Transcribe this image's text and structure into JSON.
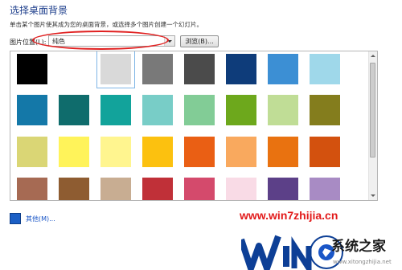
{
  "header": {
    "title": "选择桌面背景",
    "subtitle": "单击某个图片使其成为您的桌面背景，或选择多个图片创建一个幻灯片。"
  },
  "location": {
    "label": "图片位置(L):",
    "value": "纯色",
    "browse_label": "浏览(B)..."
  },
  "colors": [
    "#000000",
    "#ffffff",
    "#d9d9d9",
    "#797979",
    "#4b4b4b",
    "#0e3c7a",
    "#3c8fd4",
    "#9fd8ea",
    "#1478a8",
    "#0f6c6c",
    "#12a39b",
    "#78cdc7",
    "#82cc96",
    "#6da81c",
    "#c0dd96",
    "#847d1d",
    "#dad675",
    "#fff35a",
    "#fff58f",
    "#fcc10f",
    "#ea5f14",
    "#f9a95e",
    "#e97210",
    "#d3510e",
    "#a66a53",
    "#8e5c31",
    "#c8ad92",
    "#c03038",
    "#d44a6c",
    "#f9dbe6",
    "#5c4088",
    "#a88bc4"
  ],
  "selected_index": 2,
  "other": {
    "label": "其他(M)...",
    "color": "#1b5fc5"
  },
  "watermark": {
    "url": "www.win7zhijia.cn",
    "site": "系统之家",
    "domain": "www.xitongzhijia.net"
  }
}
